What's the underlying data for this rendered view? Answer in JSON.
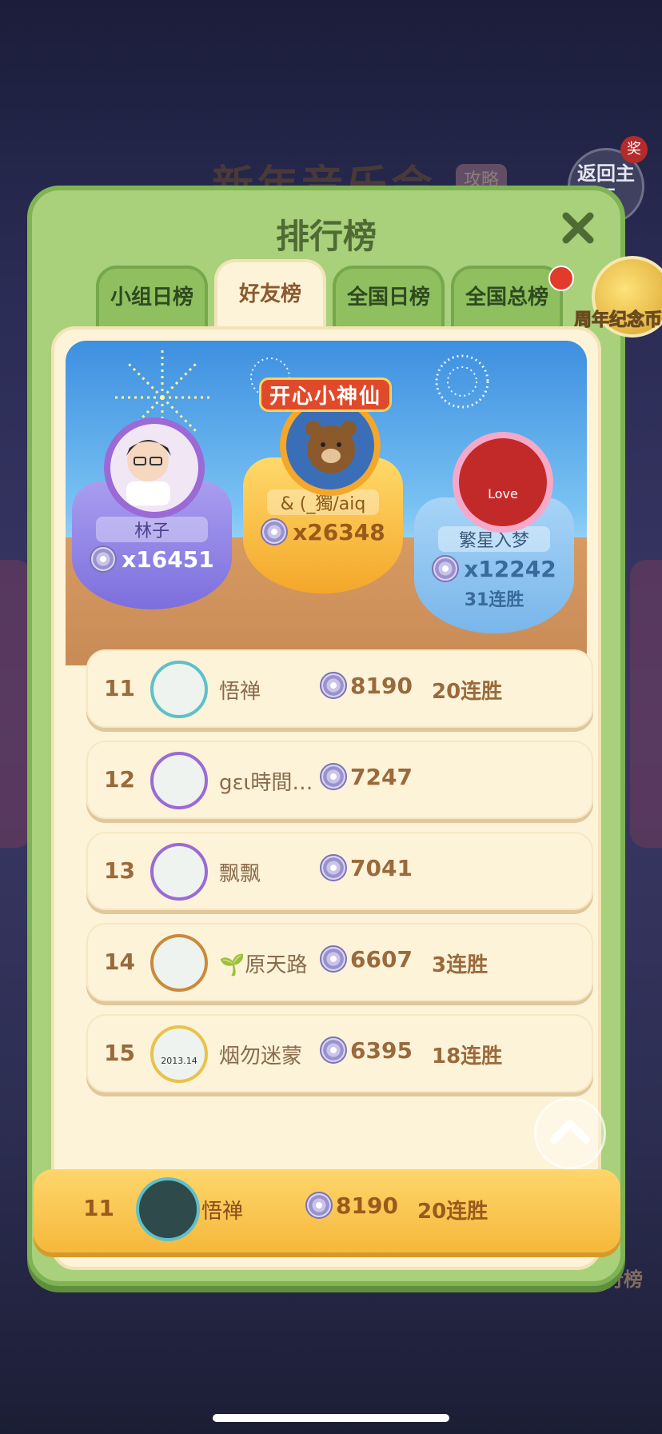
{
  "background": {
    "event_title": "新年音乐会",
    "tag": "攻略",
    "back_button": "返回主页",
    "award_badge": "奖",
    "bottom_label": "排行榜"
  },
  "panel": {
    "title": "排行榜",
    "close_icon": "close-icon",
    "tabs": [
      {
        "label": "小组日榜",
        "active": false
      },
      {
        "label": "好友榜",
        "active": true
      },
      {
        "label": "全国日榜",
        "active": false
      },
      {
        "label": "全国总榜",
        "active": false
      }
    ],
    "coin_button_label": "周年纪念币"
  },
  "podium": {
    "first": {
      "badge_text": "开心小神仙",
      "name": "& (_獨/aiq",
      "score": "x26348"
    },
    "second": {
      "name": "林子",
      "score": "x16451"
    },
    "third": {
      "name": "繁星入梦",
      "score": "x12242",
      "streak": "31连胜",
      "avatar_text": "Love"
    }
  },
  "rows": [
    {
      "rank": "11",
      "name": "悟禅",
      "score": "8190",
      "streak": "20连胜",
      "ring": "#5fc0c8"
    },
    {
      "rank": "12",
      "name": "gɛι時間d...",
      "score": "7247",
      "streak": "",
      "ring": "#9b6ad6"
    },
    {
      "rank": "13",
      "name": "飘飘",
      "score": "7041",
      "streak": "",
      "ring": "#9b6ad6"
    },
    {
      "rank": "14",
      "name": "🌱原天路",
      "score": "6607",
      "streak": "3连胜",
      "ring": "#c98a3a"
    },
    {
      "rank": "15",
      "name": "烟勿迷蒙",
      "score": "6395",
      "streak": "18连胜",
      "ring": "#e8c24a"
    }
  ],
  "row15_avatar_text": "2013.14",
  "mine": {
    "rank": "11",
    "name": "悟禅",
    "score": "8190",
    "streak": "20连胜"
  },
  "colors": {
    "panel_green": "#a9d07a",
    "gold": "#f5b83c",
    "purple": "#8c84e8",
    "blue": "#8dc3f0"
  }
}
